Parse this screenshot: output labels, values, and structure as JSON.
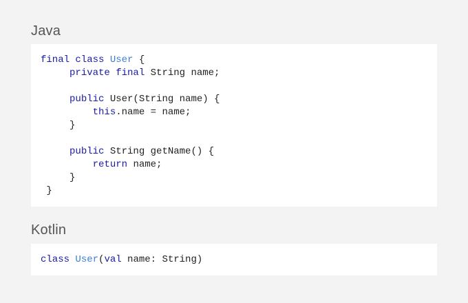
{
  "java": {
    "title": "Java",
    "lines": [
      [
        {
          "t": "final class ",
          "c": "kw"
        },
        {
          "t": "User",
          "c": "cls"
        },
        {
          "t": " {",
          "c": ""
        }
      ],
      [
        {
          "t": "     ",
          "c": ""
        },
        {
          "t": "private final ",
          "c": "kw"
        },
        {
          "t": "String name;",
          "c": ""
        }
      ],
      [],
      [
        {
          "t": "     ",
          "c": ""
        },
        {
          "t": "public ",
          "c": "kw"
        },
        {
          "t": "User(String name) {",
          "c": ""
        }
      ],
      [
        {
          "t": "         ",
          "c": ""
        },
        {
          "t": "this",
          "c": "kw"
        },
        {
          "t": ".name = name;",
          "c": ""
        }
      ],
      [
        {
          "t": "     }",
          "c": ""
        }
      ],
      [],
      [
        {
          "t": "     ",
          "c": ""
        },
        {
          "t": "public ",
          "c": "kw"
        },
        {
          "t": "String getName() {",
          "c": ""
        }
      ],
      [
        {
          "t": "         ",
          "c": ""
        },
        {
          "t": "return ",
          "c": "kw"
        },
        {
          "t": "name;",
          "c": ""
        }
      ],
      [
        {
          "t": "     }",
          "c": ""
        }
      ],
      [
        {
          "t": " }",
          "c": ""
        }
      ]
    ]
  },
  "kotlin": {
    "title": "Kotlin",
    "lines": [
      [
        {
          "t": "class ",
          "c": "kw"
        },
        {
          "t": "User",
          "c": "cls"
        },
        {
          "t": "(",
          "c": ""
        },
        {
          "t": "val ",
          "c": "kw"
        },
        {
          "t": "name: String)",
          "c": ""
        }
      ]
    ]
  },
  "colors": {
    "background": "#f3f3f3",
    "code_background": "#ffffff",
    "keyword": "#1a1aa6",
    "class_name": "#3b7fd1",
    "text": "#222222",
    "title": "#555555"
  }
}
